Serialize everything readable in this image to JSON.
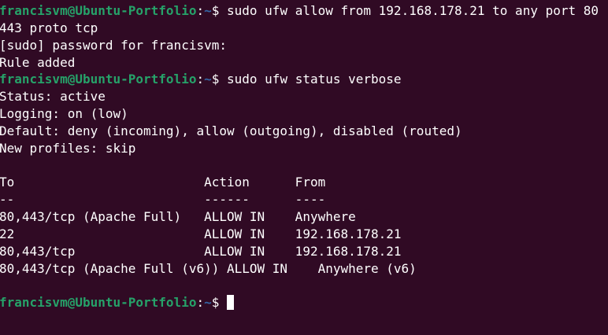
{
  "terminal": {
    "prompt_user": "francisvm@Ubuntu-Portfolio",
    "prompt_path": "~",
    "prompt_symbol": "$",
    "colors": {
      "background": "#300a24",
      "prompt_user": "#26a269",
      "prompt_path": "#3465a4",
      "text": "#ffffff"
    },
    "lines": [
      {
        "type": "prompt",
        "command": " sudo ufw allow from 192.168.178.21 to any port 80"
      },
      {
        "type": "output",
        "text": "443 proto tcp"
      },
      {
        "type": "output",
        "text": "[sudo] password for francisvm:"
      },
      {
        "type": "output",
        "text": "Rule added"
      },
      {
        "type": "prompt",
        "command": " sudo ufw status verbose"
      },
      {
        "type": "output",
        "text": "Status: active"
      },
      {
        "type": "output",
        "text": "Logging: on (low)"
      },
      {
        "type": "output",
        "text": "Default: deny (incoming), allow (outgoing), disabled (routed)"
      },
      {
        "type": "output",
        "text": "New profiles: skip"
      },
      {
        "type": "output",
        "text": ""
      },
      {
        "type": "output",
        "text": "To                         Action      From"
      },
      {
        "type": "output",
        "text": "--                         ------      ----"
      },
      {
        "type": "output",
        "text": "80,443/tcp (Apache Full)   ALLOW IN    Anywhere"
      },
      {
        "type": "output",
        "text": "22                         ALLOW IN    192.168.178.21"
      },
      {
        "type": "output",
        "text": "80,443/tcp                 ALLOW IN    192.168.178.21"
      },
      {
        "type": "output",
        "text": "80,443/tcp (Apache Full (v6)) ALLOW IN    Anywhere (v6)"
      },
      {
        "type": "output",
        "text": ""
      },
      {
        "type": "prompt",
        "command": " "
      }
    ]
  }
}
